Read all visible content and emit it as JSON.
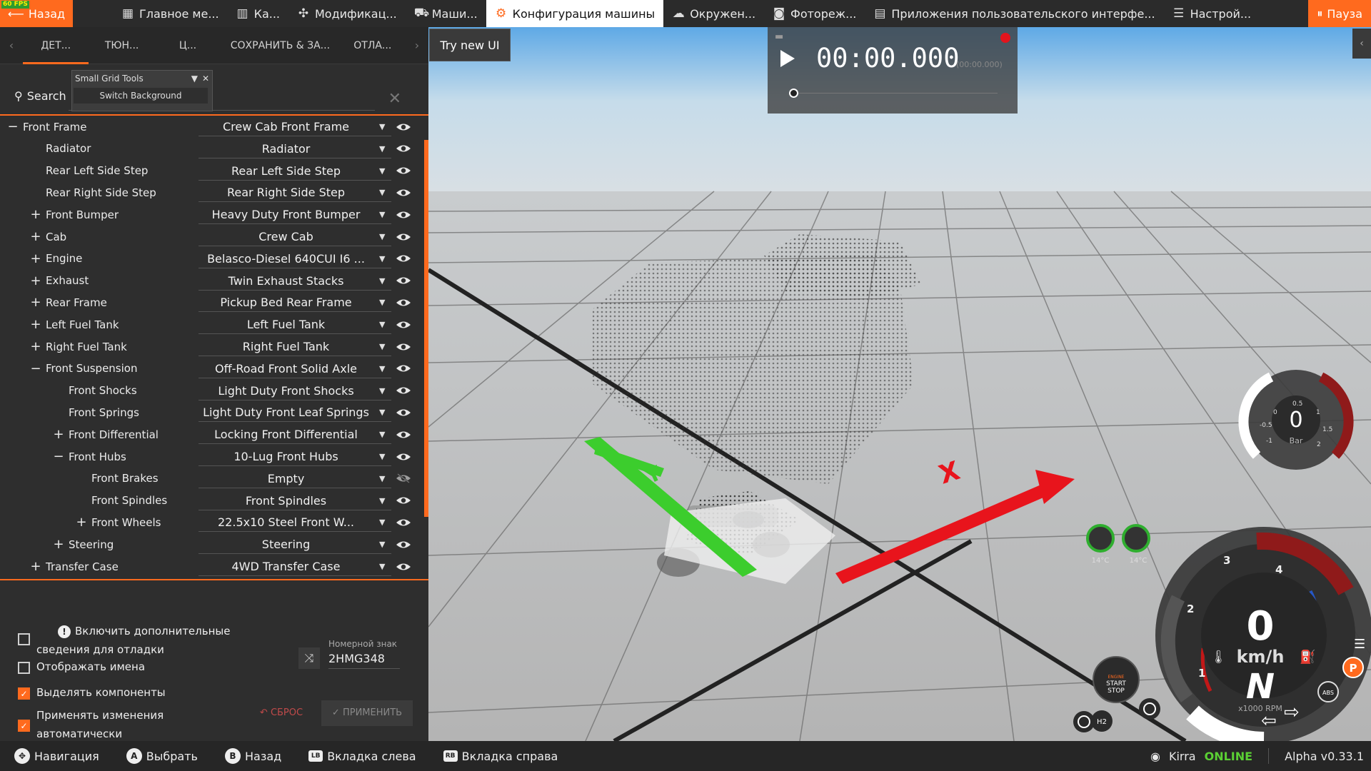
{
  "topbar": {
    "fps": "60 FPS",
    "back_label": "Назад",
    "tabs": [
      {
        "label": "Главное ме...",
        "icon": "grid-icon"
      },
      {
        "label": "Ка...",
        "icon": "map-icon"
      },
      {
        "label": "Модификац...",
        "icon": "puzzle-icon"
      },
      {
        "label": "Маши...",
        "icon": "car-icon"
      },
      {
        "label": "Конфигурация машины",
        "icon": "engine-icon"
      },
      {
        "label": "Окружен...",
        "icon": "weather-icon"
      },
      {
        "label": "Фотореж...",
        "icon": "camera-icon"
      },
      {
        "label": "Приложения пользовательского интерфе...",
        "icon": "apps-icon"
      },
      {
        "label": "Настрой...",
        "icon": "sliders-icon"
      }
    ],
    "active_tab": 4,
    "pause_label": "Пауза"
  },
  "subtabs": [
    "ДЕТ...",
    "ТЮН...",
    "Ц...",
    "СОХРАНИТЬ & ЗА...",
    "ОТЛА..."
  ],
  "search": {
    "label": "Search"
  },
  "small_grid_tools": {
    "title": "Small Grid Tools",
    "button": "Switch Background"
  },
  "parts": [
    {
      "label": "Front Frame",
      "value": "Crew Cab Front Frame",
      "depth": 0,
      "toggle": "−",
      "eye": "visible"
    },
    {
      "label": "Radiator",
      "value": "Radiator",
      "depth": 1,
      "toggle": "",
      "eye": "visible"
    },
    {
      "label": "Rear Left Side Step",
      "value": "Rear Left Side Step",
      "depth": 1,
      "toggle": "",
      "eye": "visible"
    },
    {
      "label": "Rear Right Side Step",
      "value": "Rear Right Side Step",
      "depth": 1,
      "toggle": "",
      "eye": "visible"
    },
    {
      "label": "Front Bumper",
      "value": "Heavy Duty Front Bumper",
      "depth": 1,
      "toggle": "+",
      "eye": "visible"
    },
    {
      "label": "Cab",
      "value": "Crew Cab",
      "depth": 1,
      "toggle": "+",
      "eye": "visible"
    },
    {
      "label": "Engine",
      "value": "Belasco-Diesel 640CUI I6 ...",
      "depth": 1,
      "toggle": "+",
      "eye": "visible"
    },
    {
      "label": "Exhaust",
      "value": "Twin Exhaust Stacks",
      "depth": 1,
      "toggle": "+",
      "eye": "visible"
    },
    {
      "label": "Rear Frame",
      "value": "Pickup Bed Rear Frame",
      "depth": 1,
      "toggle": "+",
      "eye": "visible"
    },
    {
      "label": "Left Fuel Tank",
      "value": "Left Fuel Tank",
      "depth": 1,
      "toggle": "+",
      "eye": "visible"
    },
    {
      "label": "Right Fuel Tank",
      "value": "Right Fuel Tank",
      "depth": 1,
      "toggle": "+",
      "eye": "visible"
    },
    {
      "label": "Front Suspension",
      "value": "Off-Road Front Solid Axle",
      "depth": 1,
      "toggle": "−",
      "eye": "visible"
    },
    {
      "label": "Front Shocks",
      "value": "Light Duty Front Shocks",
      "depth": 2,
      "toggle": "",
      "eye": "visible"
    },
    {
      "label": "Front Springs",
      "value": "Light Duty Front Leaf Springs",
      "depth": 2,
      "toggle": "",
      "eye": "visible"
    },
    {
      "label": "Front Differential",
      "value": "Locking Front Differential",
      "depth": 2,
      "toggle": "+",
      "eye": "visible"
    },
    {
      "label": "Front Hubs",
      "value": "10-Lug Front Hubs",
      "depth": 2,
      "toggle": "−",
      "eye": "visible"
    },
    {
      "label": "Front Brakes",
      "value": "Empty",
      "depth": 3,
      "toggle": "",
      "eye": "hidden"
    },
    {
      "label": "Front Spindles",
      "value": "Front Spindles",
      "depth": 3,
      "toggle": "",
      "eye": "visible"
    },
    {
      "label": "Front Wheels",
      "value": "22.5x10 Steel Front W...",
      "depth": 3,
      "toggle": "+",
      "eye": "visible"
    },
    {
      "label": "Steering",
      "value": "Steering",
      "depth": 2,
      "toggle": "+",
      "eye": "visible"
    },
    {
      "label": "Transfer Case",
      "value": "4WD Transfer Case",
      "depth": 1,
      "toggle": "+",
      "eye": "visible"
    }
  ],
  "options": {
    "debug_info": "Включить дополнительные сведения для отладки",
    "show_names": "Отображать имена",
    "highlight": "Выделять компоненты",
    "auto_apply": "Применять изменения автоматически",
    "plate_label": "Номерной знак",
    "plate_value": "2HMG348",
    "reset": "СБРОС",
    "apply": "ПРИМЕНИТЬ"
  },
  "bottombar": {
    "items": [
      {
        "key": "✥",
        "label": "Навигация"
      },
      {
        "key": "A",
        "label": "Выбрать"
      },
      {
        "key": "B",
        "label": "Назад"
      },
      {
        "key": "LB",
        "label": "Вкладка слева"
      },
      {
        "key": "RB",
        "label": "Вкладка справа"
      }
    ],
    "user": "Kirra",
    "status": "ONLINE",
    "version": "Alpha v0.33.1"
  },
  "viewport": {
    "try_new_ui": "Try new UI",
    "replay_time": "00:00.000",
    "replay_time_total": "(00:00.000)",
    "turbo_value": "0",
    "turbo_unit": "Bar",
    "turbo_ticks": [
      "-1",
      "-0.5",
      "0",
      "0.5",
      "1",
      "1.5",
      "2"
    ],
    "speed": "0",
    "speed_unit": "km/h",
    "gear": "N",
    "rpm_unit": "x1000 RPM",
    "rpm_ticks": [
      "1",
      "2",
      "3",
      "4"
    ],
    "temp_left": "14°C",
    "temp_right": "14°C",
    "engine_btn": [
      "ENGINE",
      "START",
      "STOP"
    ],
    "h2_label": "H2",
    "abs_label": "ABS",
    "park_label": "P"
  },
  "colors": {
    "accent": "#ff6a1e",
    "online": "#5bd034",
    "axis_x": "#e8141c",
    "axis_y": "#3ccd2d"
  }
}
